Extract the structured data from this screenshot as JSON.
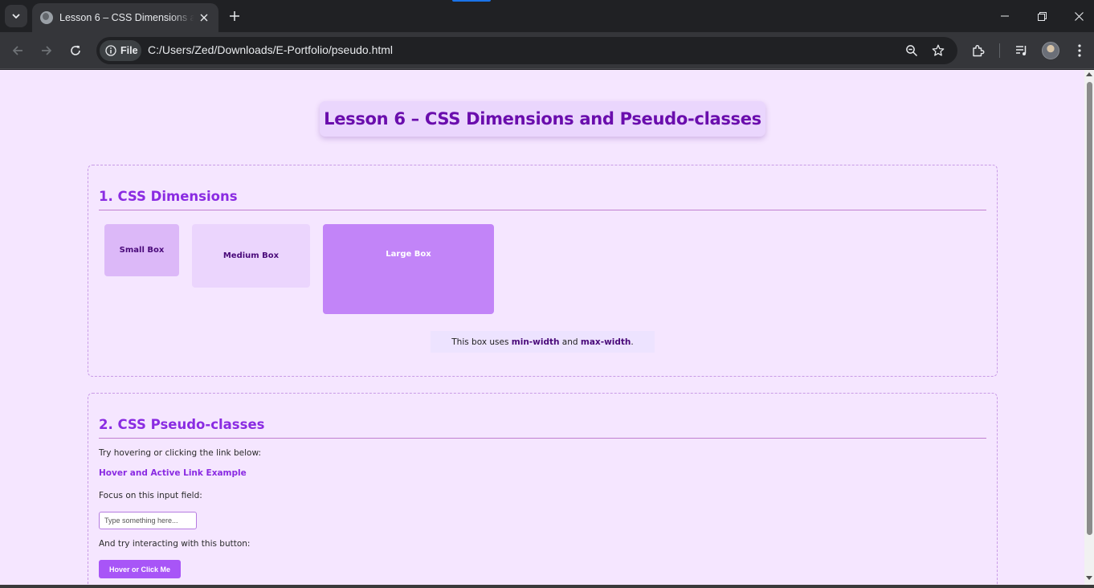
{
  "browser": {
    "tab_title": "Lesson 6 – CSS Dimensions and Pseudo-classes",
    "site_chip": "File",
    "url": "C:/Users/Zed/Downloads/E-Portfolio/pseudo.html",
    "colors": {
      "frame": "#202124",
      "toolbar": "#35363a",
      "omnibox": "#202124",
      "accent": "#1a73e8"
    },
    "icons": [
      "tab-search-icon",
      "globe-icon",
      "close-icon",
      "plus-icon",
      "minimize-icon",
      "restore-icon",
      "back-icon",
      "forward-icon",
      "reload-icon",
      "info-icon",
      "zoom-icon",
      "star-icon",
      "extensions-icon",
      "media-icon",
      "kebab-menu-icon"
    ]
  },
  "page": {
    "title": "Lesson 6 – CSS Dimensions and Pseudo-classes",
    "colors": {
      "background": "#f5e6ff",
      "heading": "#8a2be2",
      "title": "#6a0dad",
      "button": "#a855f7"
    },
    "section1": {
      "title": "1. CSS Dimensions",
      "boxes": {
        "small": "Small Box",
        "medium": "Medium Box",
        "large": "Large Box"
      },
      "minmax_before": "This box uses ",
      "minmax_min": "min-width",
      "minmax_and": " and ",
      "minmax_max": "max-width",
      "minmax_after": "."
    },
    "section2": {
      "title": "2. CSS Pseudo-classes",
      "hover_instruction": "Try hovering or clicking the link below:",
      "link_text": "Hover and Active Link Example",
      "focus_instruction": "Focus on this input field:",
      "input_placeholder": "Type something here...",
      "button_instruction": "And try interacting with this button:",
      "button_label": "Hover or Click Me"
    }
  }
}
